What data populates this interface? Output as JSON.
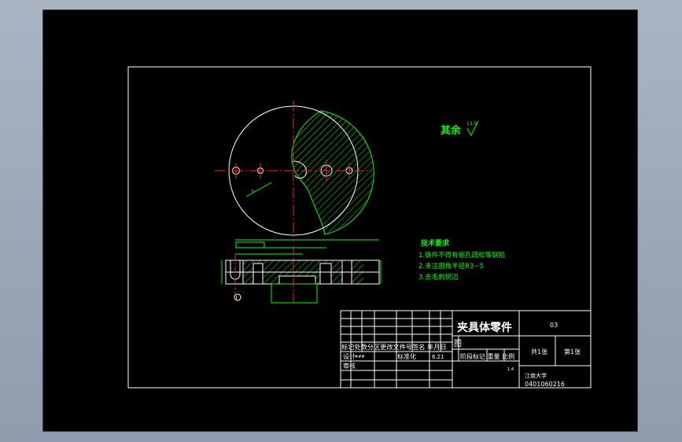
{
  "title_block": {
    "part_name": "夹具体零件",
    "drawing_no": "03",
    "cell_tu": "图",
    "header_row": "标记处数分区更改文件号签名 年月日",
    "designer_row_label": "设计",
    "designer_name": "###",
    "std_label": "标准化",
    "date_value": "6.21",
    "stage_row": "阶段标记 重量 比例",
    "scale_value": "1:4",
    "review_label": "审核",
    "sheets_total": "共1张",
    "sheet_no": "第1张",
    "school": "江南大学",
    "student_id": "0401060216"
  },
  "notes": {
    "title": "技术要求",
    "items": [
      "1.铸件不得有缩孔疏松等缺陷",
      "2.未注圆角半径R3~5",
      "3.去毛刺锐边"
    ]
  },
  "roughness": {
    "label": "其余",
    "value": "12.5"
  },
  "section_marker": "Ⅰ",
  "colors": {
    "background": "#000000",
    "lines": "#ffffff",
    "dimensions": "#00ff00",
    "centerlines": "#ff2020"
  }
}
